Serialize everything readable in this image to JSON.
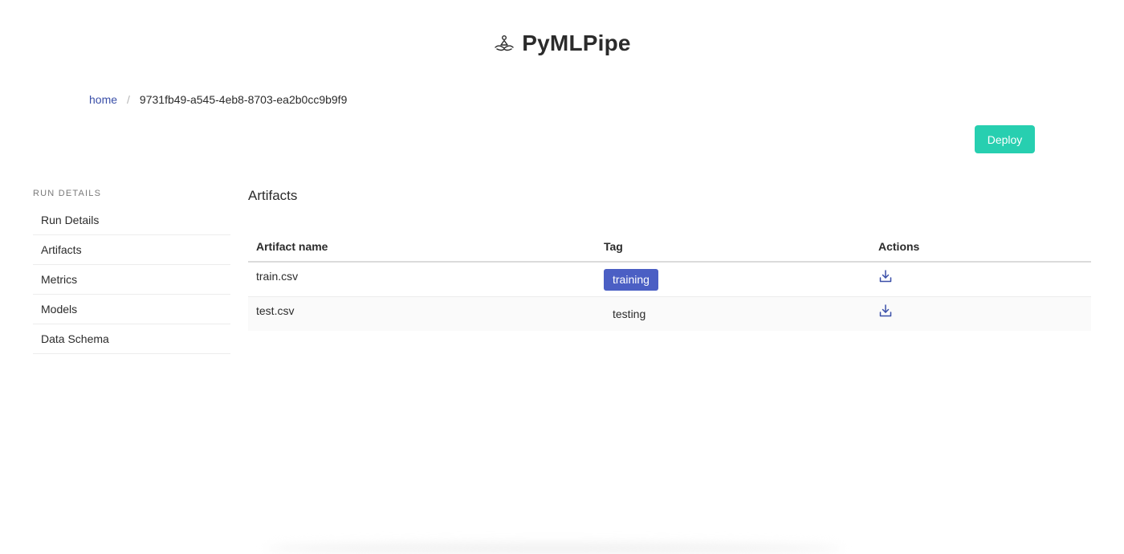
{
  "app": {
    "title": "PyMLPipe",
    "logo_icon": "lotus-icon"
  },
  "breadcrumb": {
    "home_label": "home",
    "separator": "/",
    "current": "9731fb49-a545-4eb8-8703-ea2b0cc9b9f9"
  },
  "toolbar": {
    "deploy_label": "Deploy"
  },
  "sidebar": {
    "heading": "RUN DETAILS",
    "items": [
      {
        "label": "Run Details"
      },
      {
        "label": "Artifacts"
      },
      {
        "label": "Metrics"
      },
      {
        "label": "Models"
      },
      {
        "label": "Data Schema"
      }
    ]
  },
  "main": {
    "section_title": "Artifacts",
    "table": {
      "columns": [
        "Artifact name",
        "Tag",
        "Actions"
      ],
      "rows": [
        {
          "name": "train.csv",
          "tag": "training",
          "tag_style": "primary",
          "action_icon": "download-icon"
        },
        {
          "name": "test.csv",
          "tag": "testing",
          "tag_style": "plain",
          "action_icon": "download-icon"
        }
      ]
    }
  },
  "colors": {
    "accent_teal": "#27cfb0",
    "tag_primary": "#4b5fc4",
    "link": "#3a4fa8"
  }
}
